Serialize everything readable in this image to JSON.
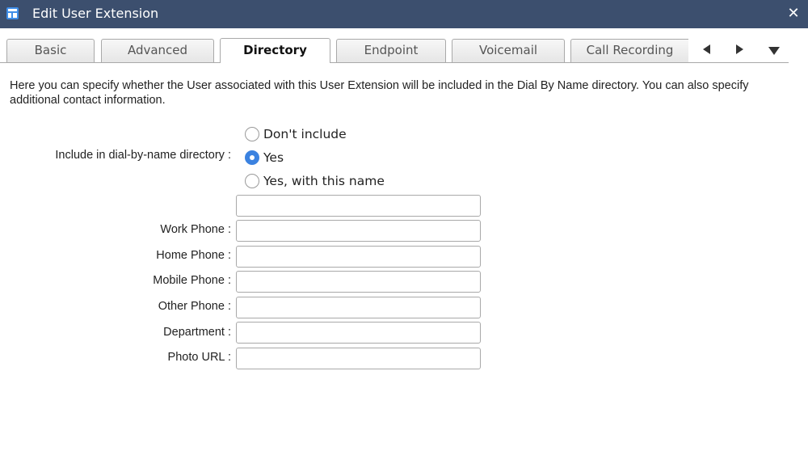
{
  "window": {
    "title": "Edit User Extension",
    "app_icon": "table-icon",
    "close_glyph": "✕"
  },
  "tabs": [
    {
      "label": "Basic",
      "active": false
    },
    {
      "label": "Advanced",
      "active": false
    },
    {
      "label": "Directory",
      "active": true
    },
    {
      "label": "Endpoint",
      "active": false
    },
    {
      "label": "Voicemail",
      "active": false
    },
    {
      "label": "Call Recording",
      "active": false
    }
  ],
  "tab_controls": {
    "prev": "triangle-left-icon",
    "next": "triangle-right-icon",
    "more": "triangle-down-icon"
  },
  "description": "Here you can specify whether the User associated with this User Extension will be included in the Dial By Name directory. You can also specify additional contact information.",
  "directory": {
    "label": "Include in dial-by-name directory :",
    "options": [
      {
        "label": "Don't include",
        "checked": false
      },
      {
        "label": "Yes",
        "checked": true
      },
      {
        "label": "Yes, with this name",
        "checked": false
      }
    ],
    "name_value": ""
  },
  "fields": [
    {
      "label": "Work Phone :",
      "value": ""
    },
    {
      "label": "Home Phone :",
      "value": ""
    },
    {
      "label": "Mobile Phone :",
      "value": ""
    },
    {
      "label": "Other Phone :",
      "value": ""
    },
    {
      "label": "Department :",
      "value": ""
    },
    {
      "label": "Photo URL :",
      "value": ""
    }
  ],
  "colors": {
    "titlebar": "#3c4f6e",
    "accent": "#3b82e0",
    "border": "#a9a9a9"
  }
}
